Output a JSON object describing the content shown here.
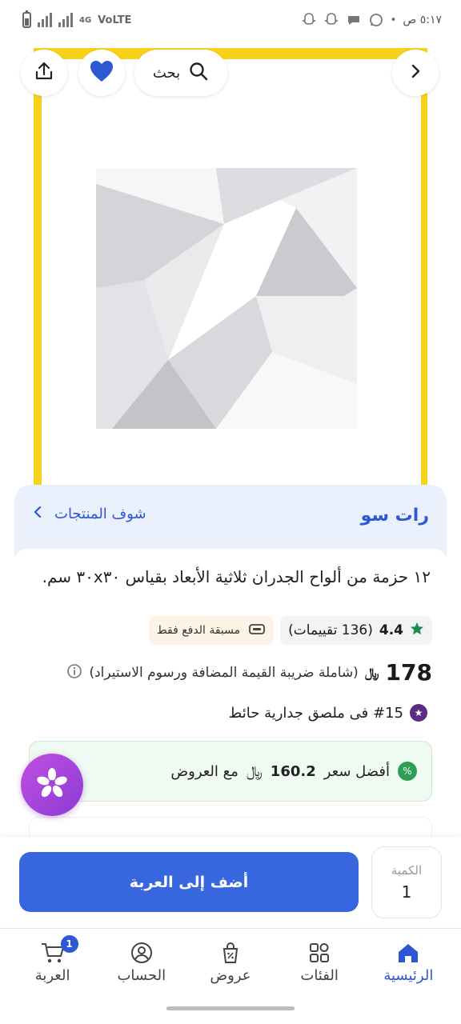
{
  "status_bar": {
    "time": "٥:١٧ ص",
    "network": "4G",
    "volte": "VoLTE"
  },
  "top_bar": {
    "search_label": "بحث"
  },
  "seller": {
    "name": "رات سو",
    "see_products": "شوف المنتجات"
  },
  "product": {
    "title": "١٢ حزمة من ألواح الجدران ثلاثية الأبعاد بقياس ٣٠x٣٠ سم.",
    "rating": "4.4",
    "reviews": "(136 تقييمات)",
    "prepaid_note": "مسبقة الدفع فقط",
    "price": "178",
    "currency_symbol": "﷼",
    "vat_note": "(شاملة ضريبة القيمة المضافة ورسوم الاستيراد)",
    "rank": "#15 فى ملصق جدارية حائط",
    "offer": {
      "prefix": "أفضل سعر",
      "price": "160.2",
      "suffix": "مع العروض"
    }
  },
  "action_bar": {
    "add_to_cart": "أضف إلى العربة",
    "quantity_label": "الكمية",
    "quantity_value": "1"
  },
  "bottom_nav": {
    "home": "الرئيسية",
    "categories": "الفئات",
    "offers": "عروض",
    "account": "الحساب",
    "cart": "العربة",
    "cart_count": "1"
  },
  "colors": {
    "accent": "#3866df",
    "brand_yellow": "#f7d21b",
    "offer_green": "#2f9d55",
    "like_heart": "#2d58d3"
  },
  "icons": [
    "back-arrow-icon",
    "search-icon",
    "heart-icon",
    "share-icon",
    "star-icon",
    "cash-icon",
    "info-icon",
    "rank-icon",
    "discount-icon",
    "home-icon",
    "categories-icon",
    "offers-icon",
    "account-icon",
    "cart-icon"
  ]
}
